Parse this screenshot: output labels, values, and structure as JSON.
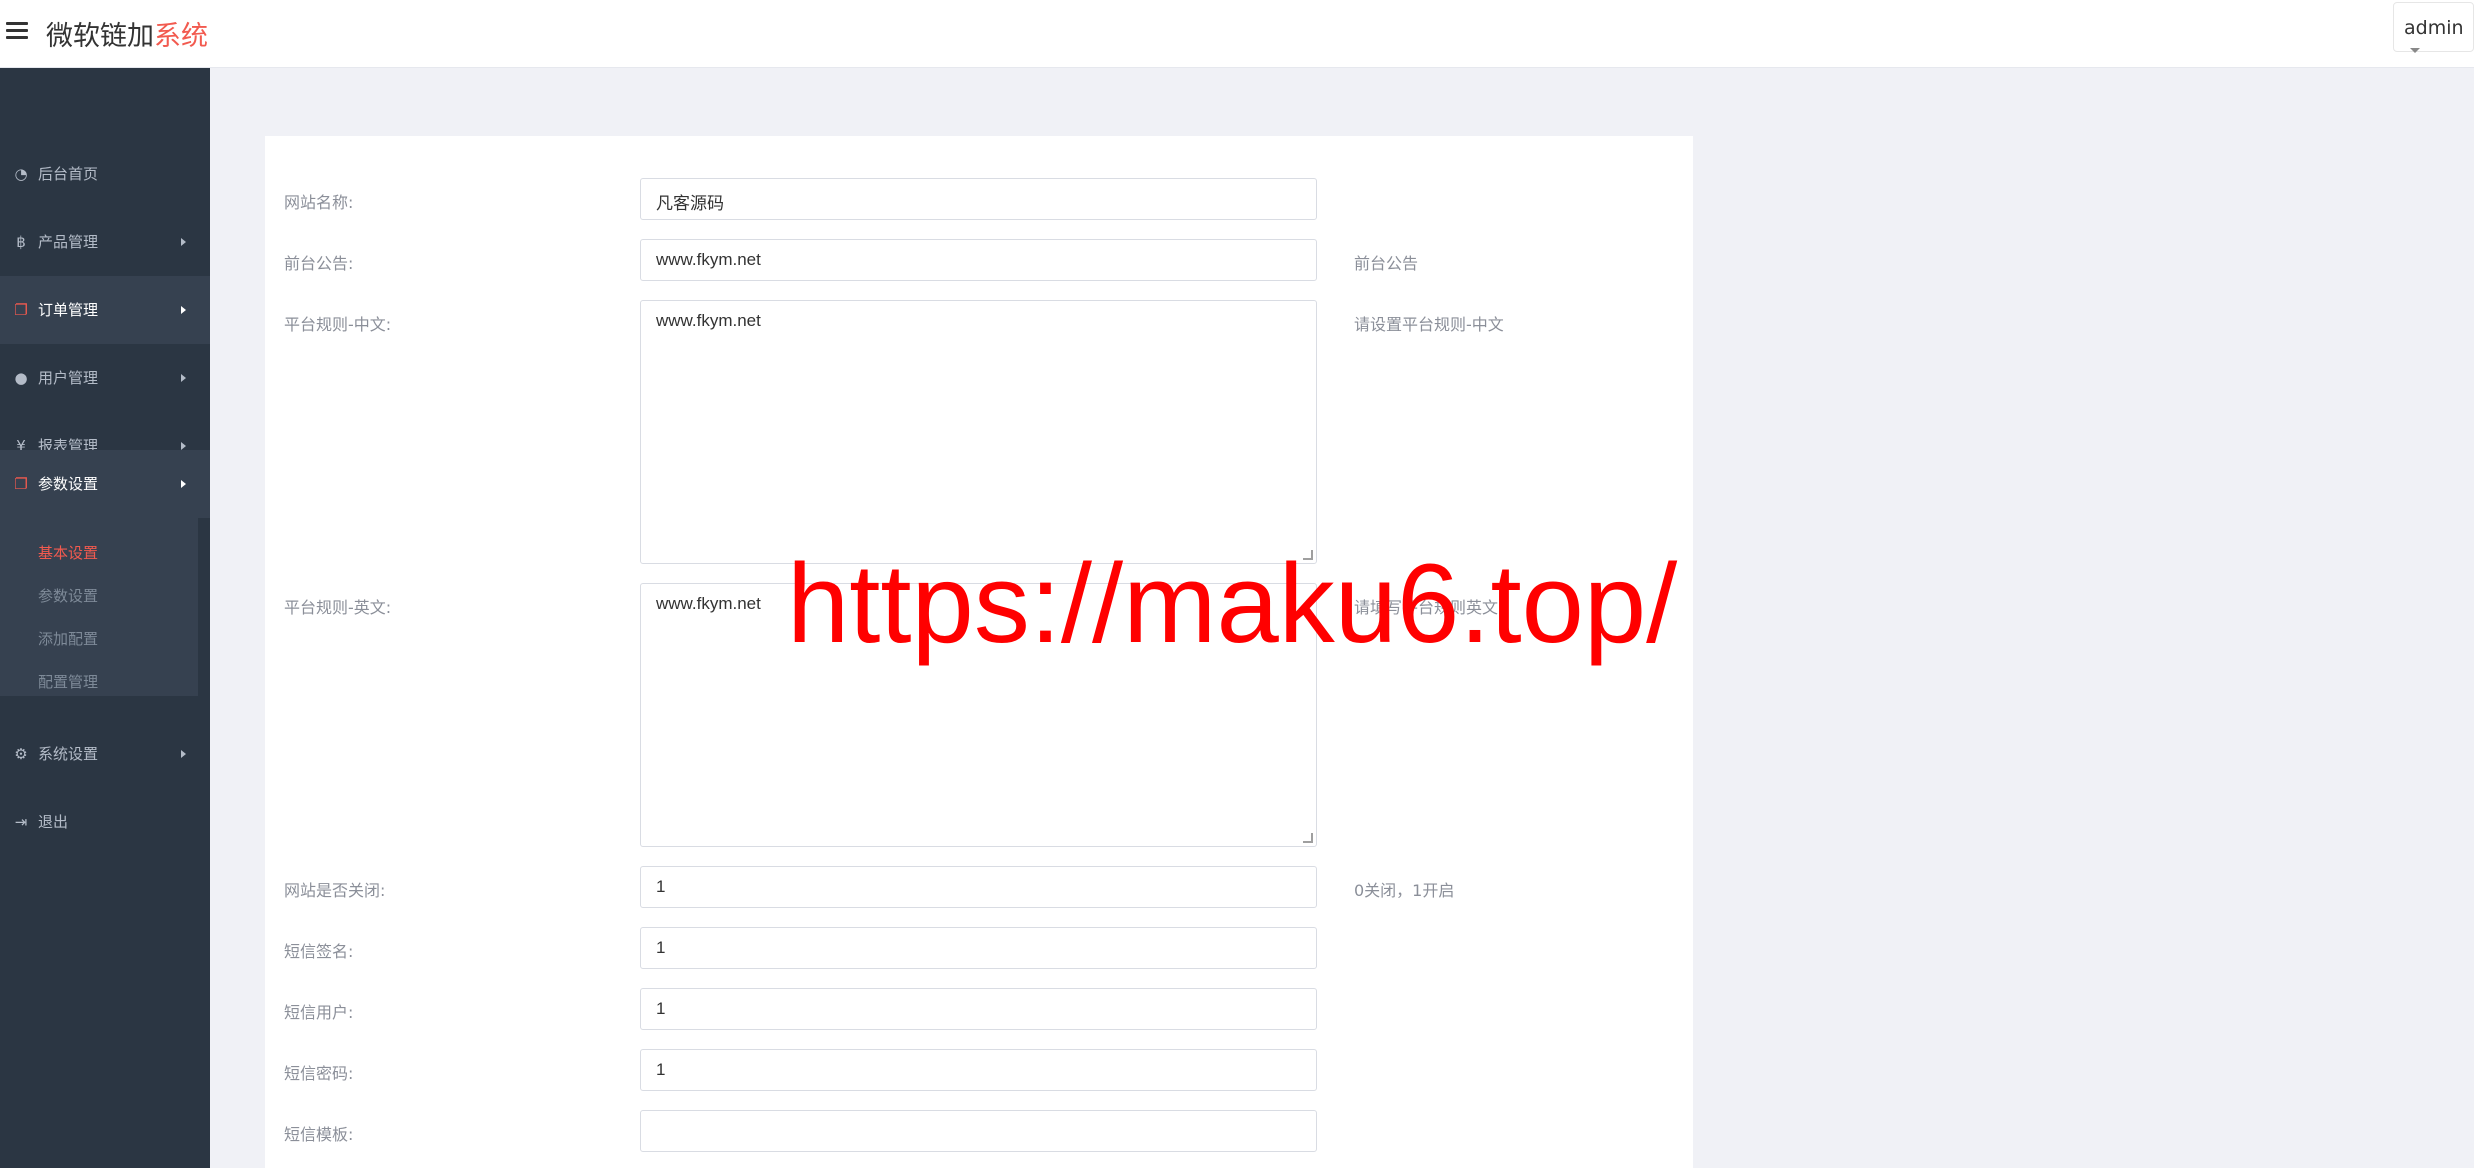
{
  "header": {
    "brand_main": "微软链加",
    "brand_accent": "系统",
    "user": "admin"
  },
  "sidebar": {
    "items": [
      {
        "label": "后台首页",
        "icon": "dashboard-icon"
      },
      {
        "label": "产品管理",
        "icon": "bitcoin-icon"
      },
      {
        "label": "订单管理",
        "icon": "copy-icon"
      },
      {
        "label": "用户管理",
        "icon": "user-icon"
      },
      {
        "label": "报表管理",
        "icon": "yen-icon"
      },
      {
        "label": "参数设置",
        "icon": "copy-icon"
      },
      {
        "label": "系统设置",
        "icon": "cogs-icon"
      },
      {
        "label": "退出",
        "icon": "sign-out-icon"
      }
    ],
    "submenu": [
      "基本设置",
      "参数设置",
      "添加配置",
      "配置管理"
    ]
  },
  "form": {
    "site_name": {
      "label": "网站名称:",
      "value": "凡客源码"
    },
    "notice": {
      "label": "前台公告:",
      "value": "www.fkym.net",
      "hint": "前台公告"
    },
    "rules_cn": {
      "label": "平台规则-中文:",
      "value": "www.fkym.net",
      "hint": "请设置平台规则-中文"
    },
    "rules_en": {
      "label": "平台规则-英文:",
      "value": "www.fkym.net",
      "hint": "请填写平台规则英文"
    },
    "site_closed": {
      "label": "网站是否关闭:",
      "value": "1",
      "hint": "0关闭，1开启"
    },
    "sms_sign": {
      "label": "短信签名:",
      "value": "1"
    },
    "sms_user": {
      "label": "短信用户:",
      "value": "1"
    },
    "sms_password": {
      "label": "短信密码:",
      "value": "1"
    },
    "sms_template": {
      "label": "短信模板:",
      "value": ""
    }
  },
  "watermark": "https://maku6.top/",
  "colors": {
    "accent": "#f25a4f",
    "sidebar_bg": "#2b3643",
    "watermark": "#ff0000"
  }
}
